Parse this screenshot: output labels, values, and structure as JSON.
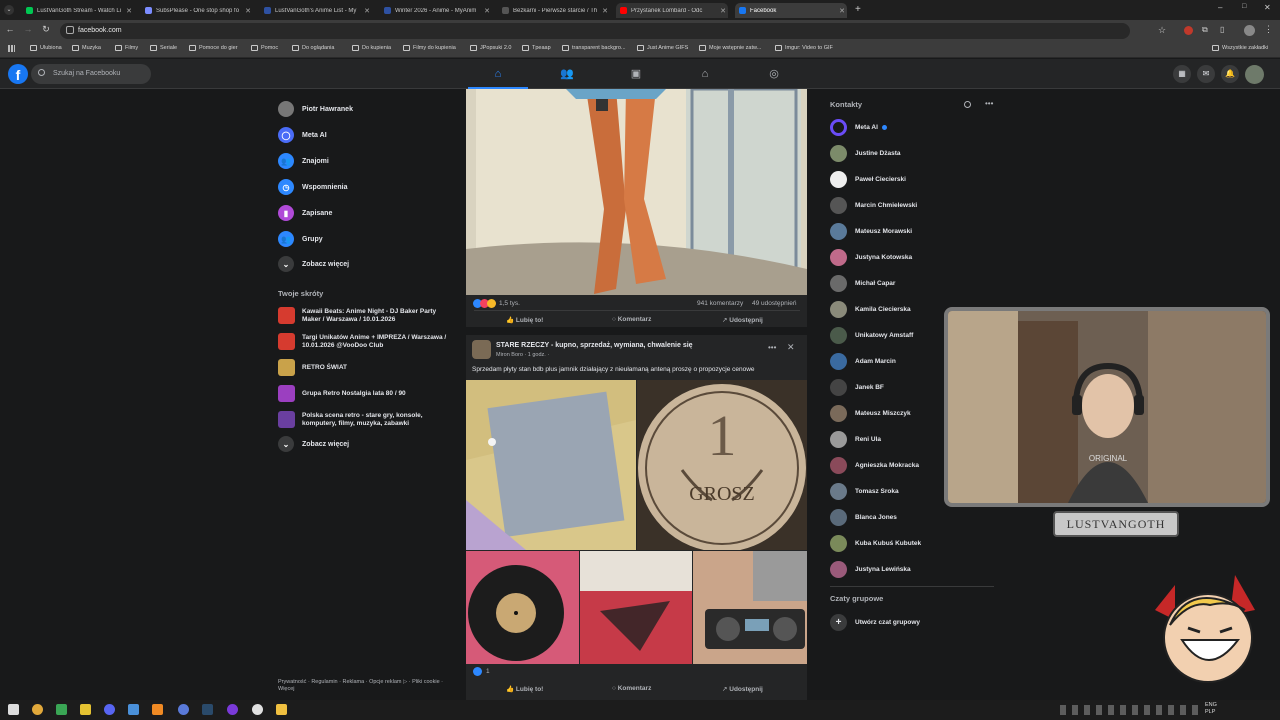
{
  "browser": {
    "tabs": [
      {
        "title": "LustVanGoth Stream - Watch Li",
        "color": "#00c853"
      },
      {
        "title": "SubsPlease - One stop shop fo",
        "color": "#7b8cff"
      },
      {
        "title": "LustVanGoth's Anime List - My",
        "color": "#2e51a2"
      },
      {
        "title": "Winter 2026 - Anime - MyAnim",
        "color": "#2e51a2"
      },
      {
        "title": "Bezkarni - Pierwsze starcie / Th",
        "color": "#555555"
      },
      {
        "title": "Przystanek Lombard - Odc",
        "color": "#ff0000"
      },
      {
        "title": "Facebook",
        "color": "#1877f2"
      }
    ],
    "url": "facebook.com",
    "bookmarks": [
      "Ulubiona",
      "Muzyka",
      "Filmy",
      "Seriale",
      "Pomoce do gier",
      "Pomoc",
      "Do oglądania",
      "Do kupienia",
      "Filmy do kupienia",
      "JPopsuki 2.0",
      "Tpeaap",
      "transparent backgro...",
      "Just Anime GIFS",
      "Moje wstępnie zatw...",
      "Imgur: Video to GIF"
    ],
    "all_bookmarks": "Wszystkie zakładki"
  },
  "fb": {
    "search_placeholder": "Szukaj na Facebooku",
    "left_nav": [
      {
        "label": "Piotr Hawranek",
        "icon": "user-avatar",
        "color": "#777777"
      },
      {
        "label": "Meta AI",
        "icon": "meta-ai-icon",
        "color": "#4a6cf7"
      },
      {
        "label": "Znajomi",
        "icon": "friends-icon",
        "color": "#2d88ff"
      },
      {
        "label": "Wspomnienia",
        "icon": "clock-icon",
        "color": "#2d88ff"
      },
      {
        "label": "Zapisane",
        "icon": "bookmark-icon",
        "color": "#b04ad8"
      },
      {
        "label": "Grupy",
        "icon": "groups-icon",
        "color": "#2d88ff"
      },
      {
        "label": "Zobacz więcej",
        "icon": "chevron-down-icon",
        "color": "#3a3b3c"
      }
    ],
    "shortcuts_title": "Twoje skróty",
    "shortcuts": [
      {
        "label": "Kawaii Beats: Anime Night - DJ Baker Party Maker / Warszawa / 10.01.2026",
        "color": "#d63b2f"
      },
      {
        "label": "Targi Unikatów Anime + IMPREZA / Warszawa / 10.01.2026 @VooDoo Club",
        "color": "#d63b2f"
      },
      {
        "label": "RETRO ŚWIAT",
        "color": "#c9a24a"
      },
      {
        "label": "Grupa Retro Nostalgia lata 80 / 90",
        "color": "#9b3fc0"
      },
      {
        "label": "Polska scena retro - stare gry, konsole, komputery, filmy, muzyka, zabawki",
        "color": "#6a3fa0"
      }
    ],
    "shortcuts_more": "Zobacz więcej",
    "footer": "Prywatność · Regulamin · Reklama · Opcje reklam ▷ · Pliki cookie · Więcej",
    "post1": {
      "reactions": "1,5 tys.",
      "comments": "941 komentarzy",
      "shares": "49 udostępnień"
    },
    "actions": {
      "like": "Lubię to!",
      "comment": "Komentarz",
      "share": "Udostępnij"
    },
    "post2": {
      "group": "STARE RZECZY - kupno, sprzedaż, wymiana, chwalenie się",
      "author": "Miron Boro · 1 godz. ·",
      "text": "Sprzedam płyty stan bdb plus jamnik działający z nieułamaną anteną proszę o propozycje cenowe",
      "reactions": "1",
      "coin_text": "GROSZ"
    },
    "contacts_title": "Kontakty",
    "contacts": [
      {
        "name": "Meta AI",
        "color": "#4a6cf7"
      },
      {
        "name": "Justine Dżasta",
        "color": "#7c8b6a"
      },
      {
        "name": "Paweł Ciecierski",
        "color": "#eeeeee"
      },
      {
        "name": "Marcin Chmielewski",
        "color": "#555555"
      },
      {
        "name": "Mateusz Morawski",
        "color": "#5a7a9a"
      },
      {
        "name": "Justyna Kotowska",
        "color": "#c06a8a"
      },
      {
        "name": "Michał Capar",
        "color": "#6a6a6a"
      },
      {
        "name": "Kamila Ciecierska",
        "color": "#8a8a7a"
      },
      {
        "name": "Unikatowy Amstaff",
        "color": "#4a5a4a"
      },
      {
        "name": "Adam Marcin",
        "color": "#3a6aa0"
      },
      {
        "name": "Janek BF",
        "color": "#444444"
      },
      {
        "name": "Mateusz Miszczyk",
        "color": "#7a6a5a"
      },
      {
        "name": "Reni Ula",
        "color": "#9a9a9a"
      },
      {
        "name": "Agnieszka Mokracka",
        "color": "#8a4a5a"
      },
      {
        "name": "Tomasz Sroka",
        "color": "#6a7a8a"
      },
      {
        "name": "Blanca Jones",
        "color": "#5a6a7a"
      },
      {
        "name": "Kuba Kubuś Kubutek",
        "color": "#7a8a5a"
      },
      {
        "name": "Justyna Lewińska",
        "color": "#9a5a7a"
      }
    ],
    "group_chats_title": "Czaty grupowe",
    "create_group_chat": "Utwórz czat grupowy"
  },
  "overlay": {
    "streamer_tag": "LUSTVANGOTH",
    "shirt_text": "ORIGINAL"
  },
  "taskbar": {
    "lang": "ENG\nPLP"
  }
}
